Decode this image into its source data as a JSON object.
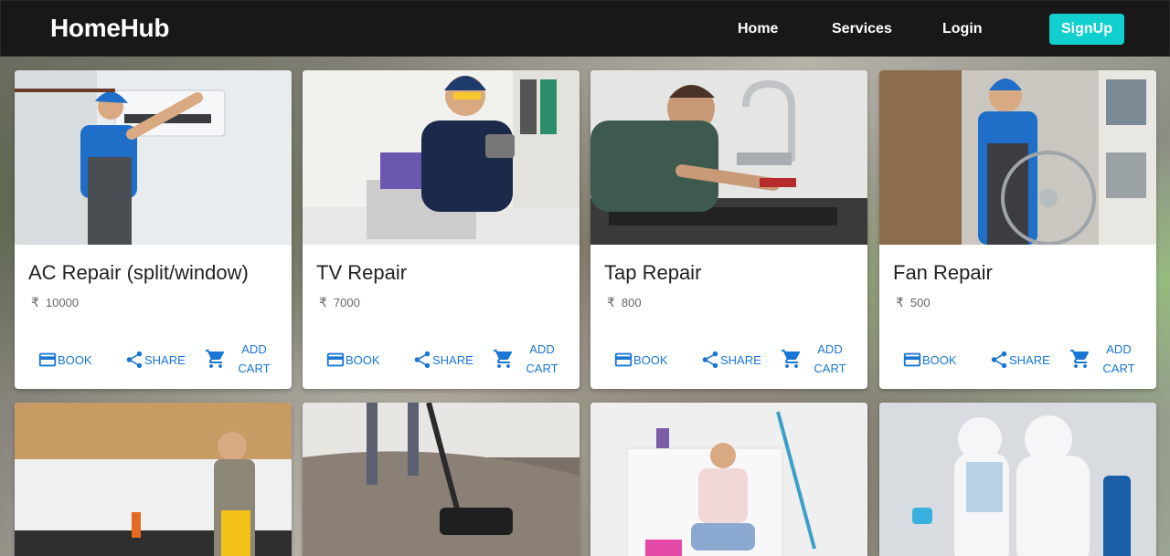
{
  "navbar": {
    "brand": "HomeHub",
    "links": [
      "Home",
      "Services",
      "Login"
    ],
    "signup": "SignUp"
  },
  "actions": {
    "book": "BOOK",
    "share": "SHARE",
    "add_cart_line1": "ADD",
    "add_cart_line2": "CART"
  },
  "currency_symbol": "₹",
  "services": [
    {
      "title": "AC Repair (split/window)",
      "price": "10000",
      "icon": "ac-technician-photo"
    },
    {
      "title": "TV Repair",
      "price": "7000",
      "icon": "electronics-technician-photo"
    },
    {
      "title": "Tap Repair",
      "price": "800",
      "icon": "plumber-photo"
    },
    {
      "title": "Fan Repair",
      "price": "500",
      "icon": "fan-technician-photo"
    }
  ],
  "second_row": [
    {
      "icon": "kitchen-cleaning-photo"
    },
    {
      "icon": "carpet-vacuum-photo"
    },
    {
      "icon": "floor-cleaning-photo"
    },
    {
      "icon": "sanitization-photo"
    }
  ]
}
